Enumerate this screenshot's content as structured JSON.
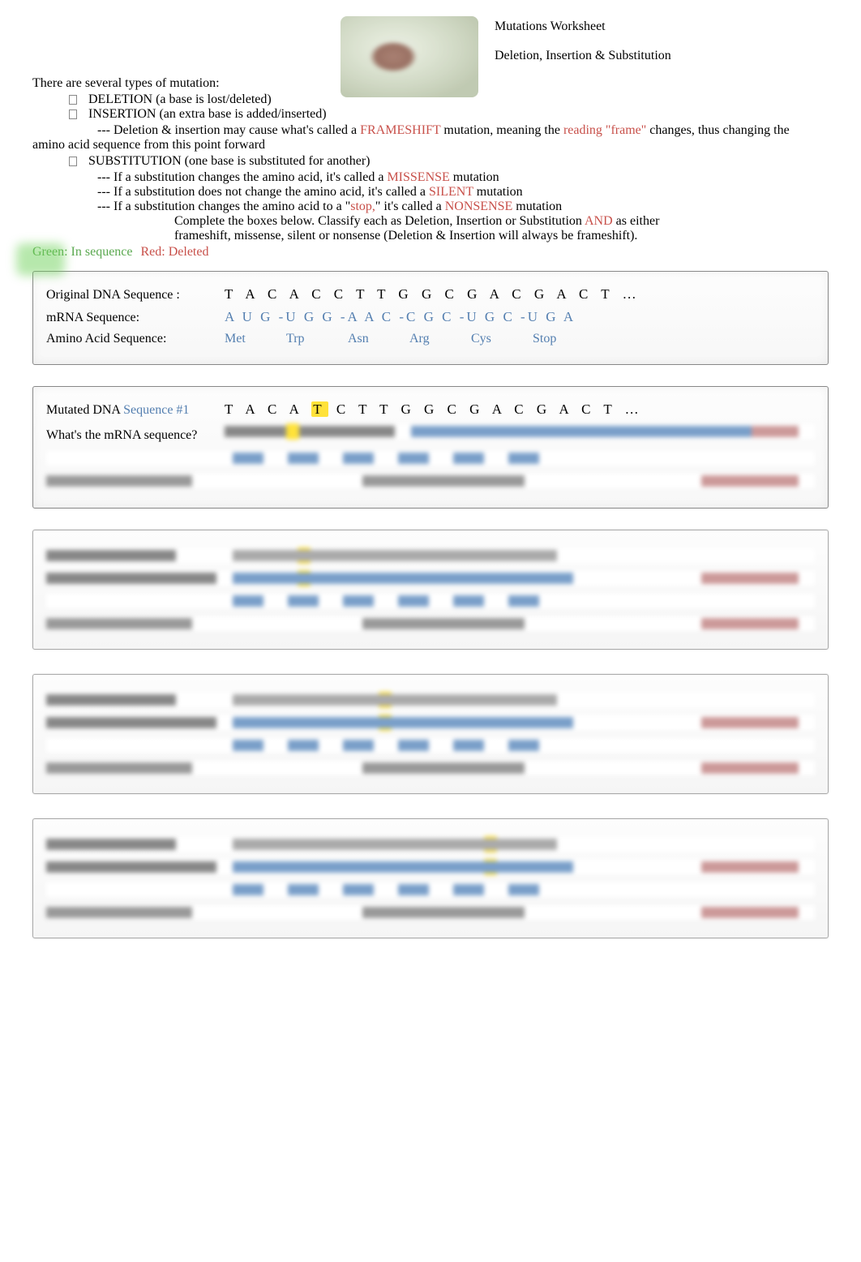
{
  "header": {
    "title": "Mutations Worksheet",
    "subtitle": "Deletion, Insertion  & Substitution"
  },
  "intro": {
    "lead": "There are several types of mutation:",
    "bullets": {
      "deletion": "DELETION (a base is lost/deleted)",
      "insertion": "INSERTION (an extra base is added/inserted)"
    },
    "frameshift_pre": "--- Deletion & insertion may cause what's called a ",
    "frameshift_word": "FRAMESHIFT",
    "frameshift_mid1": " mutation, meaning the ",
    "frameshift_quote": "reading \"frame\"",
    "frameshift_mid2": " changes, thus changing the",
    "frameshift_line2": "amino acid sequence from this point forward",
    "substitution_bullet": "SUBSTITUTION (one base is substituted for another)",
    "sub_missense_pre": "--- If a substitution changes the amino acid, it's called a ",
    "sub_missense_word": "MISSENSE",
    "sub_missense_post": " mutation",
    "sub_silent_pre": "--- If a substitution does not change the amino acid, it's called a ",
    "sub_silent_word": "SILENT",
    "sub_silent_post": " mutation",
    "sub_nonsense_pre": "--- If a substitution changes the amino acid to a \"",
    "sub_nonsense_stop": "stop,",
    "sub_nonsense_mid": "\" it's called a ",
    "sub_nonsense_word": "NONSENSE",
    "sub_nonsense_post": " mutation",
    "instructions_l1_a": "Complete the boxes below. ",
    "instructions_l1_b": "Classify each as Deletion, Insertion or Substitution ",
    "instructions_l1_c": "AND",
    "instructions_l1_d": " as either",
    "instructions_l2": "frameshift, missense, silent or nonsense (Deletion & Insertion will always be frameshift).",
    "legend_green": "Green: In sequence",
    "legend_red": "Red: Deleted"
  },
  "reference": {
    "dna_label": "Original DNA Sequence  :",
    "dna_seq": "T A C A C C T T G G C G A C G A C T …",
    "mrna_label": "mRNA Sequence:",
    "mrna_seq": "A U G -U G G -A A C -C G C -U G C -U G A",
    "aa_label": "Amino Acid Sequence:",
    "codons": [
      "Met",
      "Trp",
      "Asn",
      "Arg",
      "Cys",
      "Stop"
    ]
  },
  "mutation1": {
    "dna_label_a": "Mutated DNA ",
    "dna_label_b": "Sequence #1",
    "dna_pre": "T A C A ",
    "dna_hl": "T",
    "dna_post": " C T T G G C G A C G A C T …",
    "q1": "What's the mRNA sequence?"
  }
}
